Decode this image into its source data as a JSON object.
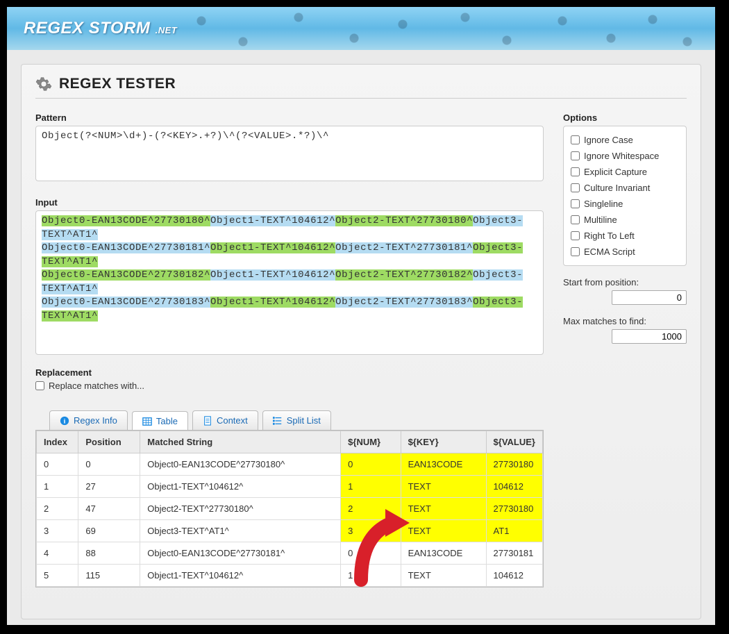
{
  "site": {
    "name": "REGEX STORM",
    "tld": ".NET"
  },
  "page": {
    "title": "REGEX TESTER"
  },
  "labels": {
    "pattern": "Pattern",
    "input": "Input",
    "options": "Options",
    "replacement": "Replacement",
    "replace_with": "Replace matches with...",
    "start_pos": "Start from position:",
    "max_matches": "Max matches to find:"
  },
  "pattern_value": "Object(?<NUM>\\d+)-(?<KEY>.+?)\\^(?<VALUE>.*?)\\^",
  "input_segments": [
    {
      "t": "Object0-EAN13CODE^27730180^",
      "c": "g"
    },
    {
      "t": "Object1-TEXT^104612^",
      "c": "b"
    },
    {
      "t": "Object2-TEXT^27730180^",
      "c": "g"
    },
    {
      "t": "Object3-TEXT^AT1^",
      "c": "b"
    },
    {
      "t": "\n",
      "c": ""
    },
    {
      "t": "Object0-EAN13CODE^27730181^",
      "c": "b"
    },
    {
      "t": "Object1-TEXT^104612^",
      "c": "g"
    },
    {
      "t": "Object2-TEXT^27730181^",
      "c": "b"
    },
    {
      "t": "Object3-TEXT^AT1^",
      "c": "g"
    },
    {
      "t": "\n",
      "c": ""
    },
    {
      "t": "Object0-EAN13CODE^27730182^",
      "c": "g"
    },
    {
      "t": "Object1-TEXT^104612^",
      "c": "b"
    },
    {
      "t": "Object2-TEXT^27730182^",
      "c": "g"
    },
    {
      "t": "Object3-TEXT^AT1^",
      "c": "b"
    },
    {
      "t": "\n",
      "c": ""
    },
    {
      "t": "Object0-EAN13CODE^27730183^",
      "c": "b"
    },
    {
      "t": "Object1-TEXT^104612^",
      "c": "g"
    },
    {
      "t": "Object2-TEXT^27730183^",
      "c": "b"
    },
    {
      "t": "Object3-TEXT^AT1^",
      "c": "g"
    }
  ],
  "options": [
    "Ignore Case",
    "Ignore Whitespace",
    "Explicit Capture",
    "Culture Invariant",
    "Singleline",
    "Multiline",
    "Right To Left",
    "ECMA Script"
  ],
  "start_pos_value": "0",
  "max_matches_value": "1000",
  "tabs": {
    "regex_info": "Regex Info",
    "table": "Table",
    "context": "Context",
    "split_list": "Split List"
  },
  "columns": {
    "index": "Index",
    "position": "Position",
    "matched": "Matched String",
    "num": "${NUM}",
    "key": "${KEY}",
    "value": "${VALUE}"
  },
  "rows": [
    {
      "index": "0",
      "position": "0",
      "matched": "Object0-EAN13CODE^27730180^",
      "num": "0",
      "key": "EAN13CODE",
      "value": "27730180",
      "hl": true
    },
    {
      "index": "1",
      "position": "27",
      "matched": "Object1-TEXT^104612^",
      "num": "1",
      "key": "TEXT",
      "value": "104612",
      "hl": true
    },
    {
      "index": "2",
      "position": "47",
      "matched": "Object2-TEXT^27730180^",
      "num": "2",
      "key": "TEXT",
      "value": "27730180",
      "hl": true
    },
    {
      "index": "3",
      "position": "69",
      "matched": "Object3-TEXT^AT1^",
      "num": "3",
      "key": "TEXT",
      "value": "AT1",
      "hl": true
    },
    {
      "index": "4",
      "position": "88",
      "matched": "Object0-EAN13CODE^27730181^",
      "num": "0",
      "key": "EAN13CODE",
      "value": "27730181",
      "hl": false
    },
    {
      "index": "5",
      "position": "115",
      "matched": "Object1-TEXT^104612^",
      "num": "1",
      "key": "TEXT",
      "value": "104612",
      "hl": false
    }
  ]
}
